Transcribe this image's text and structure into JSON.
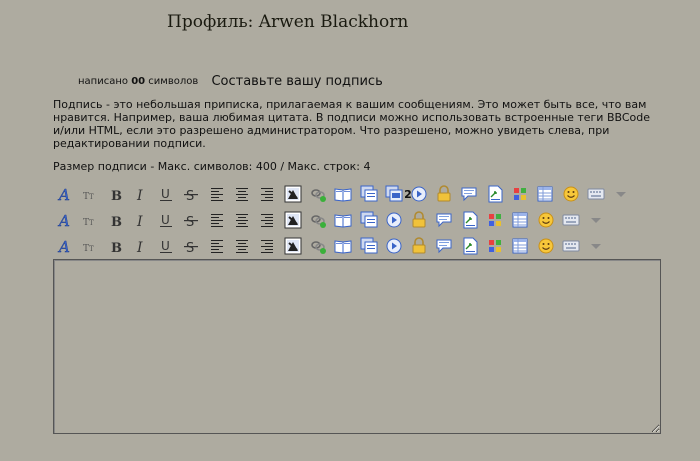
{
  "page": {
    "title": "Профиль: Arwen Blackhorn"
  },
  "counter": {
    "prefix": "написано",
    "count": "00",
    "suffix": "символов"
  },
  "heading": "Составьте вашу подпись",
  "description": "Подпись - это небольшая приписка, прилагаемая к вашим сообщениям. Это может быть все, что вам нравится. Например, ваша любимая цитата. В подписи можно использовать встроенные теги BBCode и/или HTML, если это разрешено администратором. Что разрешено, можно увидеть слева, при редактировании подписи.",
  "limits": "Размер подписи - Макс. символов: 400 / Макс. строк: 4",
  "toolbar_badge": "2",
  "toolbars": [
    [
      "font-icon",
      "font-size-icon",
      "bold-icon",
      "italic-icon",
      "underline-icon",
      "strikethrough-icon",
      "align-left-icon",
      "align-center-icon",
      "align-right-icon",
      "image-icon",
      "link-icon",
      "book-icon",
      "quote-icon",
      "code-icon",
      "play-icon",
      "lock-icon",
      "speech-bubble-icon",
      "doc-icon",
      "color-icon",
      "table-icon",
      "smiley-icon",
      "keyboard-icon",
      "dropdown-icon"
    ],
    [
      "font-icon",
      "font-size-icon",
      "bold-icon",
      "italic-icon",
      "underline-icon",
      "strikethrough-icon",
      "align-left-icon",
      "align-center-icon",
      "align-right-icon",
      "image-icon",
      "link-icon",
      "book-icon",
      "quote-icon",
      "play-icon",
      "lock-icon",
      "speech-bubble-icon",
      "doc-icon",
      "color-icon",
      "table-icon",
      "smiley-icon",
      "keyboard-icon",
      "dropdown-icon"
    ],
    [
      "font-icon",
      "font-size-icon",
      "bold-icon",
      "italic-icon",
      "underline-icon",
      "strikethrough-icon",
      "align-left-icon",
      "align-center-icon",
      "align-right-icon",
      "image-icon",
      "link-icon",
      "book-icon",
      "quote-icon",
      "play-icon",
      "lock-icon",
      "speech-bubble-icon",
      "doc-icon",
      "color-icon",
      "table-icon",
      "smiley-icon",
      "keyboard-icon",
      "dropdown-icon"
    ]
  ],
  "editor": {
    "value": ""
  }
}
